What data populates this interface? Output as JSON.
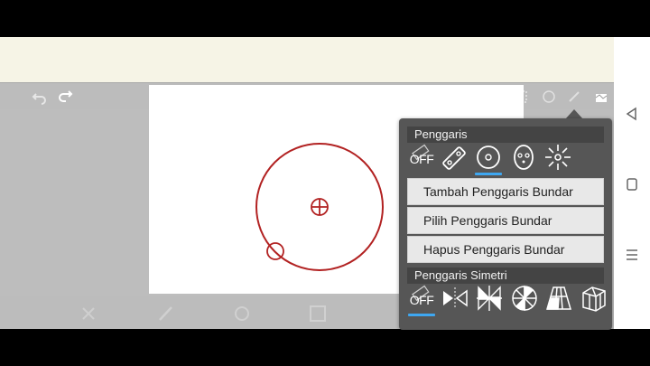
{
  "popup": {
    "ruler_section_title": "Penggaris",
    "symmetry_section_title": "Penggaris Simetri",
    "off_label": "OFF",
    "symmetry_off_label": "OFF",
    "ruler_icons": [
      "ruler-off-icon",
      "straight-ruler-icon",
      "circle-ruler-icon",
      "ellipse-ruler-icon",
      "radial-ruler-icon"
    ],
    "symmetry_icons": [
      "symmetry-off-icon",
      "mirror-symmetry-icon",
      "kaleidoscope-symmetry-icon",
      "rotational-symmetry-icon",
      "perspective-grid-icon",
      "3d-perspective-icon"
    ],
    "menu": [
      {
        "label": "Tambah Penggaris Bundar"
      },
      {
        "label": "Pilih Penggaris Bundar"
      },
      {
        "label": "Hapus Penggaris Bundar"
      }
    ],
    "selected_color": "#3ea7f1"
  },
  "canvas": {
    "stroke_color": "#b22222"
  }
}
